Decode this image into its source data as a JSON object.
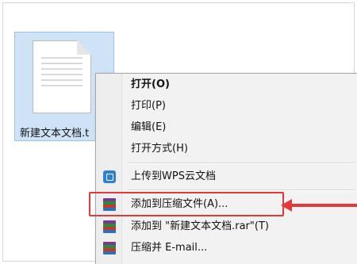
{
  "file": {
    "name": "新建文本文档.t",
    "icon": "text-document-icon"
  },
  "context_menu": {
    "items": [
      {
        "label": "打开(O)",
        "bold": true
      },
      {
        "label": "打印(P)"
      },
      {
        "label": "编辑(E)"
      },
      {
        "label": "打开方式(H)"
      },
      {
        "label": "上传到WPS云文档",
        "icon": "wps-cloud-icon"
      },
      {
        "label": "添加到压缩文件(A)...",
        "icon": "winrar-icon"
      },
      {
        "label": "添加到 \"新建文本文档.rar\"(T)",
        "icon": "winrar-icon"
      },
      {
        "label": "压缩并 E-mail...",
        "icon": "winrar-icon"
      }
    ]
  },
  "annotation": {
    "highlight_color": "#e23a3a"
  }
}
